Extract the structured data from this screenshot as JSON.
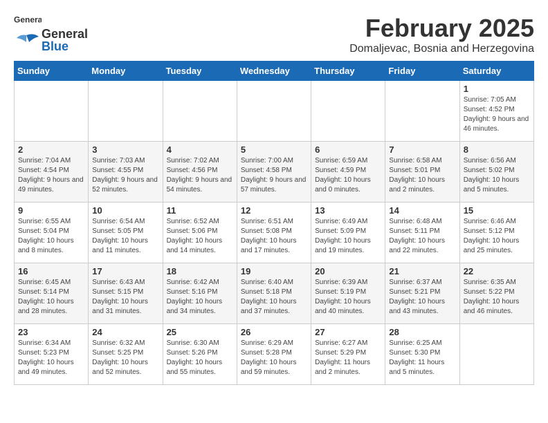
{
  "header": {
    "logo_general": "General",
    "logo_blue": "Blue",
    "month_title": "February 2025",
    "subtitle": "Domaljevac, Bosnia and Herzegovina"
  },
  "days_of_week": [
    "Sunday",
    "Monday",
    "Tuesday",
    "Wednesday",
    "Thursday",
    "Friday",
    "Saturday"
  ],
  "weeks": [
    [
      {
        "day": "",
        "info": ""
      },
      {
        "day": "",
        "info": ""
      },
      {
        "day": "",
        "info": ""
      },
      {
        "day": "",
        "info": ""
      },
      {
        "day": "",
        "info": ""
      },
      {
        "day": "",
        "info": ""
      },
      {
        "day": "1",
        "info": "Sunrise: 7:05 AM\nSunset: 4:52 PM\nDaylight: 9 hours and 46 minutes."
      }
    ],
    [
      {
        "day": "2",
        "info": "Sunrise: 7:04 AM\nSunset: 4:54 PM\nDaylight: 9 hours and 49 minutes."
      },
      {
        "day": "3",
        "info": "Sunrise: 7:03 AM\nSunset: 4:55 PM\nDaylight: 9 hours and 52 minutes."
      },
      {
        "day": "4",
        "info": "Sunrise: 7:02 AM\nSunset: 4:56 PM\nDaylight: 9 hours and 54 minutes."
      },
      {
        "day": "5",
        "info": "Sunrise: 7:00 AM\nSunset: 4:58 PM\nDaylight: 9 hours and 57 minutes."
      },
      {
        "day": "6",
        "info": "Sunrise: 6:59 AM\nSunset: 4:59 PM\nDaylight: 10 hours and 0 minutes."
      },
      {
        "day": "7",
        "info": "Sunrise: 6:58 AM\nSunset: 5:01 PM\nDaylight: 10 hours and 2 minutes."
      },
      {
        "day": "8",
        "info": "Sunrise: 6:56 AM\nSunset: 5:02 PM\nDaylight: 10 hours and 5 minutes."
      }
    ],
    [
      {
        "day": "9",
        "info": "Sunrise: 6:55 AM\nSunset: 5:04 PM\nDaylight: 10 hours and 8 minutes."
      },
      {
        "day": "10",
        "info": "Sunrise: 6:54 AM\nSunset: 5:05 PM\nDaylight: 10 hours and 11 minutes."
      },
      {
        "day": "11",
        "info": "Sunrise: 6:52 AM\nSunset: 5:06 PM\nDaylight: 10 hours and 14 minutes."
      },
      {
        "day": "12",
        "info": "Sunrise: 6:51 AM\nSunset: 5:08 PM\nDaylight: 10 hours and 17 minutes."
      },
      {
        "day": "13",
        "info": "Sunrise: 6:49 AM\nSunset: 5:09 PM\nDaylight: 10 hours and 19 minutes."
      },
      {
        "day": "14",
        "info": "Sunrise: 6:48 AM\nSunset: 5:11 PM\nDaylight: 10 hours and 22 minutes."
      },
      {
        "day": "15",
        "info": "Sunrise: 6:46 AM\nSunset: 5:12 PM\nDaylight: 10 hours and 25 minutes."
      }
    ],
    [
      {
        "day": "16",
        "info": "Sunrise: 6:45 AM\nSunset: 5:14 PM\nDaylight: 10 hours and 28 minutes."
      },
      {
        "day": "17",
        "info": "Sunrise: 6:43 AM\nSunset: 5:15 PM\nDaylight: 10 hours and 31 minutes."
      },
      {
        "day": "18",
        "info": "Sunrise: 6:42 AM\nSunset: 5:16 PM\nDaylight: 10 hours and 34 minutes."
      },
      {
        "day": "19",
        "info": "Sunrise: 6:40 AM\nSunset: 5:18 PM\nDaylight: 10 hours and 37 minutes."
      },
      {
        "day": "20",
        "info": "Sunrise: 6:39 AM\nSunset: 5:19 PM\nDaylight: 10 hours and 40 minutes."
      },
      {
        "day": "21",
        "info": "Sunrise: 6:37 AM\nSunset: 5:21 PM\nDaylight: 10 hours and 43 minutes."
      },
      {
        "day": "22",
        "info": "Sunrise: 6:35 AM\nSunset: 5:22 PM\nDaylight: 10 hours and 46 minutes."
      }
    ],
    [
      {
        "day": "23",
        "info": "Sunrise: 6:34 AM\nSunset: 5:23 PM\nDaylight: 10 hours and 49 minutes."
      },
      {
        "day": "24",
        "info": "Sunrise: 6:32 AM\nSunset: 5:25 PM\nDaylight: 10 hours and 52 minutes."
      },
      {
        "day": "25",
        "info": "Sunrise: 6:30 AM\nSunset: 5:26 PM\nDaylight: 10 hours and 55 minutes."
      },
      {
        "day": "26",
        "info": "Sunrise: 6:29 AM\nSunset: 5:28 PM\nDaylight: 10 hours and 59 minutes."
      },
      {
        "day": "27",
        "info": "Sunrise: 6:27 AM\nSunset: 5:29 PM\nDaylight: 11 hours and 2 minutes."
      },
      {
        "day": "28",
        "info": "Sunrise: 6:25 AM\nSunset: 5:30 PM\nDaylight: 11 hours and 5 minutes."
      },
      {
        "day": "",
        "info": ""
      }
    ]
  ]
}
